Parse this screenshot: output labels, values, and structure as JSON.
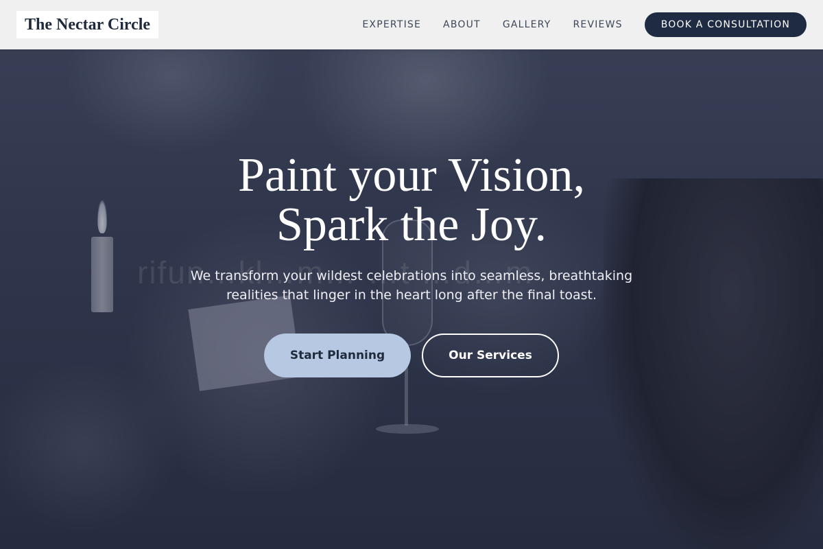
{
  "brand": {
    "name": "The Nectar Circle"
  },
  "nav": {
    "links": [
      "EXPERTISE",
      "ABOUT",
      "GALLERY",
      "REVIEWS"
    ],
    "cta_label": "BOOK A CONSULTATION"
  },
  "hero": {
    "headline_line1": "Paint your Vision,",
    "headline_line2": "Spark the Joy.",
    "subheadline": "We transform your wildest celebrations into seamless, breathtaking realities that linger in the heart long after the final toast.",
    "primary_button": "Start Planning",
    "secondary_button": "Our Services",
    "watermark": "rifun…kl…m… …t …d…m"
  },
  "colors": {
    "header_bg": "#f0f0f0",
    "cta_bg": "#1e2b42",
    "primary_button_bg": "#b6c8e2",
    "text_dark": "#1f2a3c"
  }
}
